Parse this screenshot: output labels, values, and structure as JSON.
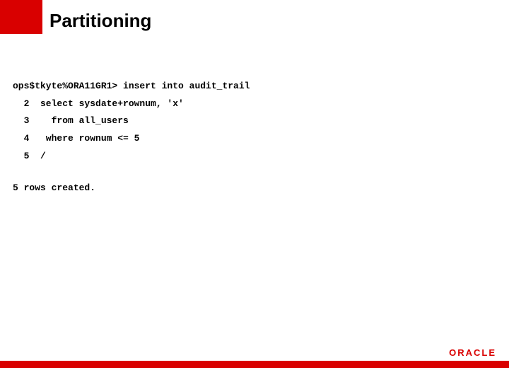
{
  "title": "Partitioning",
  "code": {
    "line1": "ops$tkyte%ORA11GR1> insert into audit_trail",
    "line2": "  2  select sysdate+rownum, 'x'",
    "line3": "  3    from all_users",
    "line4": "  4   where rownum <= 5",
    "line5": "  5  /"
  },
  "result": "5 rows created.",
  "logo": "ORACLE"
}
